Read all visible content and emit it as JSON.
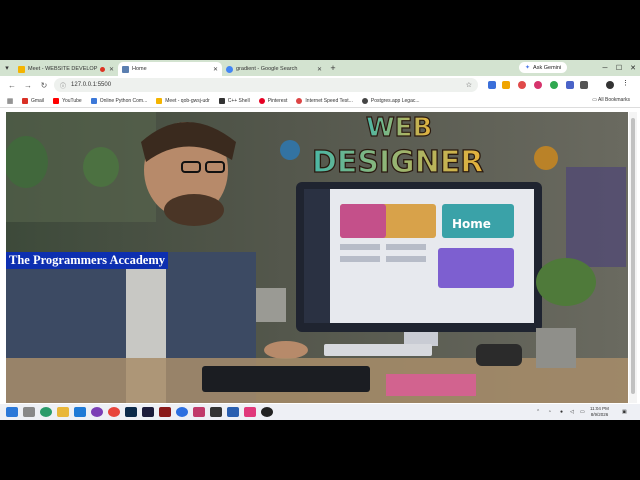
{
  "browser": {
    "tabs": [
      {
        "label": "Meet - WEBSITE DEVELOP",
        "active": false,
        "recording": true
      },
      {
        "label": "Home",
        "active": true,
        "recording": false
      },
      {
        "label": "gradient - Google Search",
        "active": false,
        "recording": false
      }
    ],
    "new_tab_symbol": "+",
    "gemini_label": "Ask Gemini",
    "url": "127.0.0.1:5500",
    "bookmarks": [
      {
        "label": "Gmail",
        "color": "#d93025"
      },
      {
        "label": "YouTube",
        "color": "#ff0000"
      },
      {
        "label": "Online Python Com...",
        "color": "#3c78d8"
      },
      {
        "label": "Meet - qob-gwsj-udr",
        "color": "#f4b400"
      },
      {
        "label": "C++ Shell",
        "color": "#333333"
      },
      {
        "label": "Pinterest",
        "color": "#e60023"
      },
      {
        "label": "Internet Speed Test...",
        "color": "#d44"
      },
      {
        "label": "Postgres.app Legac...",
        "color": "#444444"
      }
    ],
    "all_bookmarks": "All Bookmarks"
  },
  "page": {
    "site_title": "The Programmers Accademy",
    "hero_text_line1": "WEB",
    "hero_text_line2": "DESIGNER",
    "monitor_card_label": "Home"
  },
  "taskbar": {
    "time": "11:04 PM",
    "date": "8/9/2026"
  },
  "colors": {
    "tab_strip": "#d3e3d0",
    "title_bg": "#0d2fb0",
    "taskbar_bg": "#eef0f5"
  }
}
